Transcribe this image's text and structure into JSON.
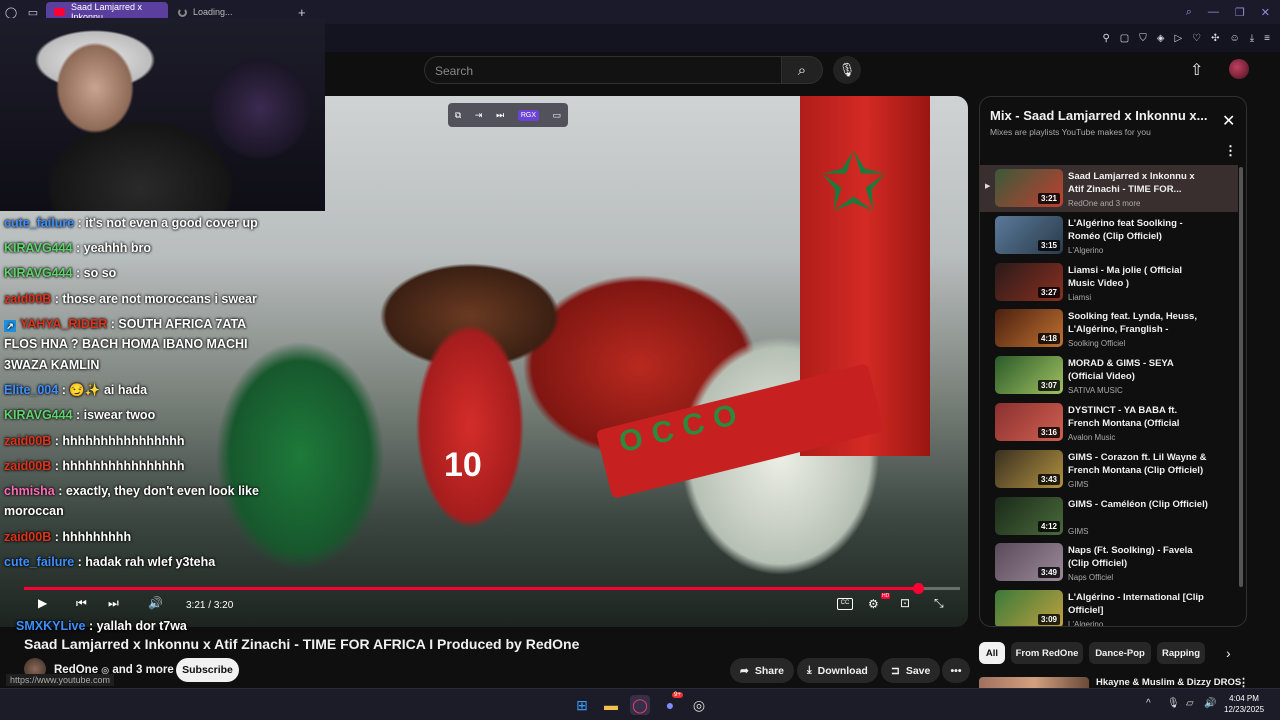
{
  "browser": {
    "tabs": [
      {
        "label": "Saad Lamjarred x Inkonnu"
      },
      {
        "label": "Loading..."
      }
    ],
    "new_tab": "+"
  },
  "search": {
    "placeholder": "Search"
  },
  "video": {
    "jersey_number": "10",
    "scarf_text": "OCCO",
    "time_current": "3:21",
    "time_total": "3:20",
    "progress": 0.955,
    "title": "Saad Lamjarred x Inkonnu x Atif Zinachi - TIME FOR AFRICA I Produced by RedOne",
    "channel": "RedOne",
    "channel_suffix": "and 3 more",
    "subscribe": "Subscribe",
    "share": "Share",
    "download": "Download",
    "save": "Save",
    "miniplayer_badge": "RGX",
    "status_url": "https://www.youtube.com"
  },
  "chat": [
    {
      "user": "cute_failure",
      "color": "blue",
      "text": "it's not even a good cover up"
    },
    {
      "user": "KIRAVG444",
      "color": "green",
      "text": "yeahhh bro"
    },
    {
      "user": "KIRAVG444",
      "color": "green",
      "text": "so so"
    },
    {
      "user": "zaid00B",
      "color": "red",
      "text": "those are not moroccans i swear"
    },
    {
      "user": "YAHYA_RIDER",
      "color": "red",
      "badge": true,
      "text": "SOUTH AFRICA 7ATA FLOS HNA ? BACH HOMA IBANO MACHI 3WAZA KAMLIN"
    },
    {
      "user": "Elite_004",
      "color": "blue",
      "emote": "😏✨",
      "text": "ai hada"
    },
    {
      "user": "KIRAVG444",
      "color": "green",
      "text": "iswear twoo"
    },
    {
      "user": "zaid00B",
      "color": "red",
      "text": "hhhhhhhhhhhhhhhh"
    },
    {
      "user": "zaid00B",
      "color": "red",
      "text": "hhhhhhhhhhhhhhhh"
    },
    {
      "user": "chmisha",
      "color": "pink",
      "text": "exactly, they don't even look like moroccan"
    },
    {
      "user": "zaid00B",
      "color": "red",
      "text": "hhhhhhhhh"
    },
    {
      "user": "cute_failure",
      "color": "blue",
      "text": "hadak rah wlef y3teha"
    }
  ],
  "chat_last": {
    "user": "SMXKYLive",
    "color": "blue",
    "text": "yallah dor t7wa"
  },
  "playlist": {
    "title": "Mix - Saad Lamjarred x Inkonnu x...",
    "subtitle": "Mixes are playlists YouTube makes for you",
    "items": [
      {
        "title": "Saad Lamjarred x Inkonnu x Atif Zinachi - TIME FOR...",
        "channel": "RedOne and 3 more",
        "duration": "3:21",
        "current": true,
        "thumb": [
          "#3a5a3a",
          "#c04030"
        ]
      },
      {
        "title": "L'Algérino feat Soolking - Roméo (Clip Officiel)",
        "channel": "L'Algerino",
        "duration": "3:15",
        "thumb": [
          "#5a7a9a",
          "#2a3a4a"
        ]
      },
      {
        "title": "Liamsi - Ma jolie ( Official Music Video )",
        "channel": "Liamsi",
        "duration": "3:27",
        "thumb": [
          "#2a1a1a",
          "#8a3020"
        ]
      },
      {
        "title": "Soolking feat. Lynda, Heuss, L'Algérino, Franglish - Jennife...",
        "channel": "Soolking Officiel",
        "duration": "4:18",
        "thumb": [
          "#4a2010",
          "#c07030"
        ]
      },
      {
        "title": "MORAD & GIMS - SEYA (Official Video)",
        "channel": "SATIVA MUSIC",
        "duration": "3:07",
        "thumb": [
          "#2a5a2a",
          "#a0c060"
        ]
      },
      {
        "title": "DYSTINCT - YA BABA ft. French Montana (Official Mus...",
        "channel": "Avalon Music",
        "duration": "3:16",
        "thumb": [
          "#8a3030",
          "#d06050"
        ]
      },
      {
        "title": "GIMS - Corazon ft. Lil Wayne & French Montana (Clip Officiel)",
        "channel": "GIMS",
        "duration": "3:43",
        "thumb": [
          "#3a3020",
          "#b09040"
        ]
      },
      {
        "title": "GIMS - Caméléon (Clip Officiel)",
        "channel": "GIMS",
        "duration": "4:12",
        "thumb": [
          "#1a2a1a",
          "#4a6a3a"
        ]
      },
      {
        "title": "Naps (Ft. Soolking) - Favela (Clip Officiel)",
        "channel": "Naps Officiel",
        "duration": "3:49",
        "thumb": [
          "#5a4a5a",
          "#9a8a9a"
        ]
      },
      {
        "title": "L'Algérino - International [Clip Officiel]",
        "channel": "L'Algerino",
        "duration": "3:09",
        "thumb": [
          "#3a7a3a",
          "#c0a040"
        ]
      }
    ]
  },
  "chips": [
    "All",
    "From RedOne",
    "Dance-Pop",
    "Rapping"
  ],
  "next_up": {
    "title": "Hkayne & Muslim & Dizzy DROS"
  },
  "taskbar": {
    "time": "4:04 PM",
    "date": "12/23/2025",
    "discord_badge": "9+"
  }
}
